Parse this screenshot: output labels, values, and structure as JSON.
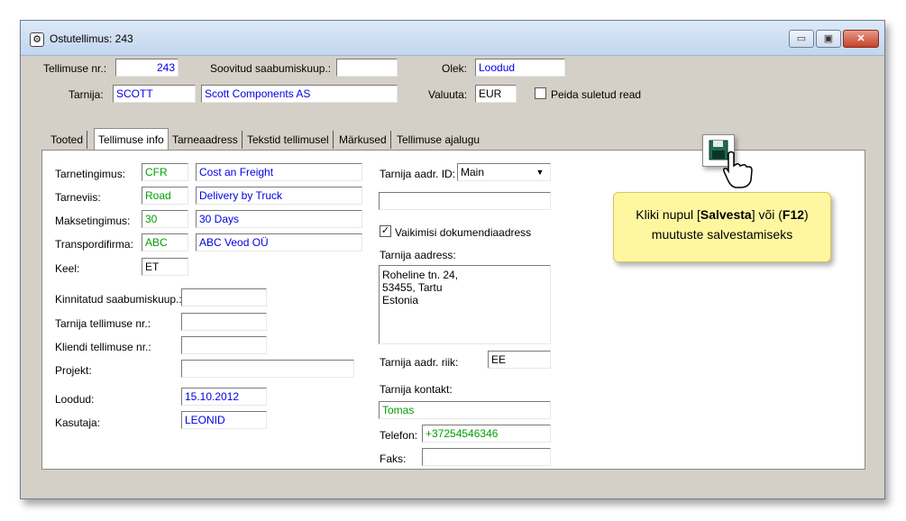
{
  "window": {
    "title": "Ostutellimus: 243",
    "controls": {
      "minimize": "▭",
      "maximize": "▣",
      "close": "✕"
    }
  },
  "header": {
    "order_no_label": "Tellimuse nr.:",
    "order_no": "243",
    "desired_arrival_label": "Soovitud saabumiskuup.:",
    "desired_arrival": "",
    "status_label": "Olek:",
    "status": "Loodud",
    "supplier_label": "Tarnija:",
    "supplier_code": "SCOTT",
    "supplier_name": "Scott Components AS",
    "currency_label": "Valuuta:",
    "currency": "EUR",
    "hide_closed_label": "Peida suletud read",
    "hide_closed_checked": false
  },
  "tabs": [
    {
      "label": "Tooted"
    },
    {
      "label": "Tellimuse info"
    },
    {
      "label": "Tarneaadress"
    },
    {
      "label": "Tekstid tellimusel"
    },
    {
      "label": "Märkused"
    },
    {
      "label": "Tellimuse ajalugu"
    }
  ],
  "info": {
    "delivery_terms_label": "Tarnetingimus:",
    "delivery_terms_code": "CFR",
    "delivery_terms_name": "Cost an Freight",
    "delivery_method_label": "Tarneviis:",
    "delivery_method_code": "Road",
    "delivery_method_name": "Delivery by Truck",
    "payment_terms_label": "Maksetingimus:",
    "payment_terms_code": "30",
    "payment_terms_name": "30 Days",
    "transport_label": "Transpordifirma:",
    "transport_code": "ABC",
    "transport_name": "ABC Veod OÜ",
    "language_label": "Keel:",
    "language": "ET",
    "confirmed_arrival_label": "Kinnitatud saabumiskuup.:",
    "confirmed_arrival": "",
    "supplier_order_label": "Tarnija tellimuse nr.:",
    "supplier_order": "",
    "customer_order_label": "Kliendi tellimuse nr.:",
    "customer_order": "",
    "project_label": "Projekt:",
    "project": "",
    "created_label": "Loodud:",
    "created": "15.10.2012",
    "user_label": "Kasutaja:",
    "user": "LEONID"
  },
  "address": {
    "addr_id_label": "Tarnija aadr. ID:",
    "addr_id": "Main",
    "addr_extra": "",
    "default_doc_label": "Vaikimisi dokumendiaadress",
    "default_doc_checked": true,
    "address_label": "Tarnija aadress:",
    "address_lines": [
      "Roheline tn. 24,",
      "53455, Tartu",
      "Estonia"
    ],
    "country_label": "Tarnija aadr. riik:",
    "country": "EE",
    "contact_label": "Tarnija kontakt:",
    "contact": "Tomas",
    "phone_label": "Telefon:",
    "phone": "+37254546346",
    "fax_label": "Faks:",
    "fax": ""
  },
  "tooltip": {
    "pre": "Kliki nupul [",
    "save_word": "Salvesta",
    "mid": "] või (",
    "key": "F12",
    "post": ")",
    "line2": "muutuste salvestamiseks"
  },
  "icons": {
    "save": "floppy-disk-icon",
    "cursor": "hand-cursor-icon",
    "app": "app-gear-icon"
  },
  "colors": {
    "blue_value": "#0000e6",
    "green_value": "#00a000",
    "tooltip_bg": "#fff6a0"
  }
}
